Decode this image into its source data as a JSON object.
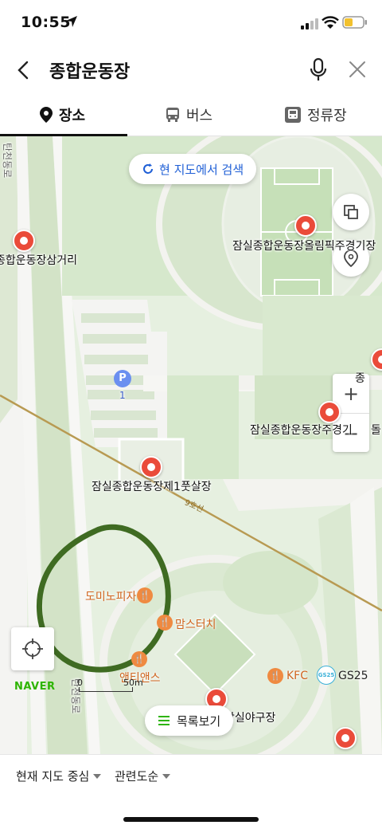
{
  "status_bar": {
    "time": "10:55"
  },
  "search": {
    "query": "종합운동장"
  },
  "tabs": [
    {
      "label": "장소",
      "icon": "place-pin-icon",
      "active": true
    },
    {
      "label": "버스",
      "icon": "bus-icon",
      "active": false
    },
    {
      "label": "정류장",
      "icon": "bus-stop-icon",
      "active": false
    }
  ],
  "map": {
    "search_here_label": "현 지도에서 검색",
    "labels": {
      "olympic_stadium": "잠실종합운동장올림픽주경기장",
      "sub_stadium": "잠실종합운동장주경기",
      "futsal": "잠실종합운동장제1풋살장",
      "intersection": "종합운동장삼거리",
      "road_left": "탄천동로",
      "road_bottom": "탄천동로",
      "baseball": "잠실야구장",
      "dome_partial": "돌",
      "stadium_partial": "종",
      "subway_line": "9호선",
      "parking_number": "1"
    },
    "pois": [
      {
        "label": "도미노피자",
        "icon": "fork-knife-icon"
      },
      {
        "label": "맘스터치",
        "icon": "fork-knife-icon"
      },
      {
        "label": "앤티앤스",
        "icon": "fork-knife-icon"
      },
      {
        "label": "KFC",
        "icon": "fork-knife-icon"
      },
      {
        "label": "GS25",
        "icon": "convenience-store-icon"
      }
    ],
    "brand": "NAVER",
    "scale": {
      "start": "0",
      "end": "50m"
    },
    "list_button_label": "목록보기",
    "annotation_color": "#3f6b22",
    "subway_line_color": "#b89a52"
  },
  "bottom_bar": {
    "filter_location": "현재 지도 중심",
    "filter_sort": "관련도순"
  },
  "colors": {
    "accent_blue": "#1f5fd6",
    "pin_red": "#ea4b3a",
    "brand_green": "#2db400"
  }
}
